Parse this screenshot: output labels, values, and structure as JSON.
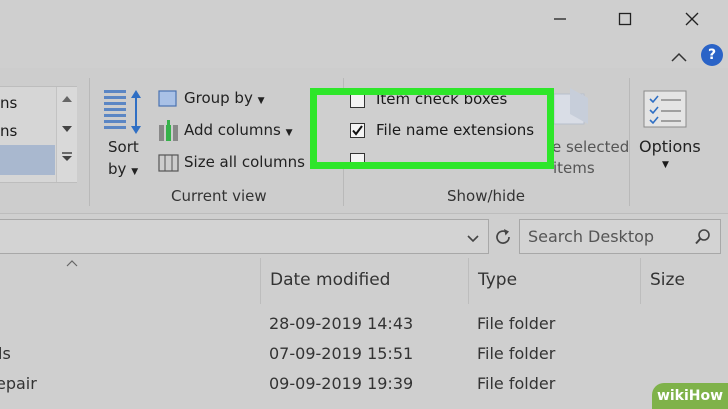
{
  "titlebar": {
    "minimize_icon": "minimize-icon",
    "maximize_icon": "maximize-icon",
    "close_icon": "close-icon"
  },
  "ribbon_controls": {
    "collapse_icon": "chevron-up-icon",
    "help_icon": "help-icon",
    "help_glyph": "?"
  },
  "layout": {
    "rows": [
      "ns",
      "ns",
      ""
    ]
  },
  "current_view": {
    "sort_by_line1": "Sort",
    "sort_by_line2": "by",
    "group_by": "Group by",
    "add_columns": "Add columns",
    "size_all_columns": "Size all columns to",
    "group_label": "Current view"
  },
  "show_hide": {
    "item_check_boxes": "Item check boxes",
    "file_name_extensions": "File name extensions",
    "file_name_extensions_checked": true,
    "hide_selected_line1": "Hide selected",
    "hide_selected_line2": "items",
    "group_label": "Show/hide",
    "highlight_color": "#2ee62a"
  },
  "options": {
    "label": "Options"
  },
  "address_bar": {
    "refresh_icon": "refresh-icon",
    "search_placeholder": "Search Desktop"
  },
  "file_list": {
    "columns": [
      "Date modified",
      "Type",
      "Size"
    ],
    "rows": [
      {
        "name": "",
        "date": "28-09-2019 14:43",
        "type": "File folder"
      },
      {
        "name": "ls",
        "date": "07-09-2019 15:51",
        "type": "File folder"
      },
      {
        "name": "epair",
        "date": "09-09-2019 19:39",
        "type": "File folder"
      }
    ]
  },
  "watermark": {
    "text": "wikiHow"
  },
  "colors": {
    "background": "#cfcfcf",
    "selection": "#a9b8cf",
    "help_blue": "#2a63c7"
  }
}
